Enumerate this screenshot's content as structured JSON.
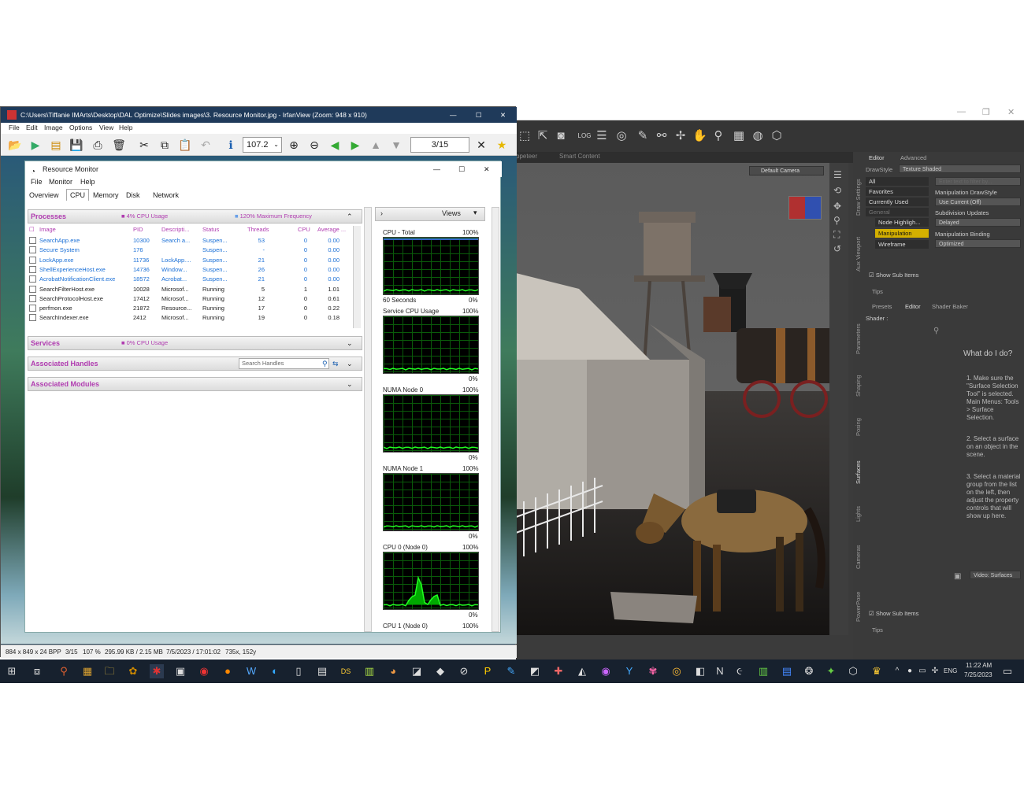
{
  "irfanview": {
    "title": "C:\\Users\\Tiffanie IMArts\\Desktop\\DAL Optimize\\Slides images\\3. Resource Monitor.jpg - IrfanView (Zoom: 948 x 910)",
    "menu": [
      "File",
      "Edit",
      "Image",
      "Options",
      "View",
      "Help"
    ],
    "zoom_value": "107.2",
    "page_value": "3/15",
    "status": [
      "884 x 849 x 24 BPP",
      "3/15",
      "107 %",
      "295.99 KB / 2.15 MB",
      "7/5/2023 / 17:01:02",
      "735x, 152y"
    ]
  },
  "resmon": {
    "title": "Resource Monitor",
    "menu": [
      "File",
      "Monitor",
      "Help"
    ],
    "tabs": [
      "Overview",
      "CPU",
      "Memory",
      "Disk",
      "Network"
    ],
    "processes": {
      "title": "Processes",
      "cpu_usage": "4% CPU Usage",
      "max_freq": "120% Maximum Frequency",
      "columns": [
        "Image",
        "PID",
        "Descripti...",
        "Status",
        "Threads",
        "CPU",
        "Average ..."
      ],
      "rows": [
        {
          "image": "SearchApp.exe",
          "pid": "10300",
          "desc": "Search a...",
          "status": "Suspen...",
          "threads": "53",
          "cpu": "0",
          "avg": "0.00",
          "suspended": true
        },
        {
          "image": "Secure System",
          "pid": "176",
          "desc": "",
          "status": "Suspen...",
          "threads": "-",
          "cpu": "0",
          "avg": "0.00",
          "suspended": true
        },
        {
          "image": "LockApp.exe",
          "pid": "11736",
          "desc": "LockApp....",
          "status": "Suspen...",
          "threads": "21",
          "cpu": "0",
          "avg": "0.00",
          "suspended": true
        },
        {
          "image": "ShellExperienceHost.exe",
          "pid": "14736",
          "desc": "Window...",
          "status": "Suspen...",
          "threads": "26",
          "cpu": "0",
          "avg": "0.00",
          "suspended": true
        },
        {
          "image": "AcrobatNotificationClient.exe",
          "pid": "18572",
          "desc": "Acrobat...",
          "status": "Suspen...",
          "threads": "21",
          "cpu": "0",
          "avg": "0.00",
          "suspended": true
        },
        {
          "image": "SearchFilterHost.exe",
          "pid": "10028",
          "desc": "Microsof...",
          "status": "Running",
          "threads": "5",
          "cpu": "1",
          "avg": "1.01",
          "suspended": false
        },
        {
          "image": "SearchProtocolHost.exe",
          "pid": "17412",
          "desc": "Microsof...",
          "status": "Running",
          "threads": "12",
          "cpu": "0",
          "avg": "0.61",
          "suspended": false
        },
        {
          "image": "perfmon.exe",
          "pid": "21872",
          "desc": "Resource...",
          "status": "Running",
          "threads": "17",
          "cpu": "0",
          "avg": "0.22",
          "suspended": false
        },
        {
          "image": "SearchIndexer.exe",
          "pid": "2412",
          "desc": "Microsof...",
          "status": "Running",
          "threads": "19",
          "cpu": "0",
          "avg": "0.18",
          "suspended": false
        }
      ]
    },
    "services": {
      "title": "Services",
      "cpu_usage": "0% CPU Usage"
    },
    "handles": {
      "title": "Associated Handles",
      "search_placeholder": "Search Handles"
    },
    "modules": {
      "title": "Associated Modules"
    },
    "views_label": "Views",
    "graphs": [
      {
        "label": "CPU - Total",
        "max": "100%",
        "foot_left": "60 Seconds",
        "foot_right": "0%"
      },
      {
        "label": "Service CPU Usage",
        "max": "100%",
        "foot_left": "",
        "foot_right": "0%"
      },
      {
        "label": "NUMA Node 0",
        "max": "100%",
        "foot_left": "",
        "foot_right": "0%"
      },
      {
        "label": "NUMA Node 1",
        "max": "100%",
        "foot_left": "",
        "foot_right": "0%"
      },
      {
        "label": "CPU 0 (Node 0)",
        "max": "100%",
        "foot_left": "",
        "foot_right": "0%"
      },
      {
        "label": "CPU 1 (Node 0)",
        "max": "100%",
        "foot_left": "",
        "foot_right": ""
      }
    ]
  },
  "daz": {
    "tabs": [
      "ppeteer",
      "Smart Content"
    ],
    "camera": "Default Camera",
    "toolbar_log": "LOG",
    "panel": {
      "top_tabs": [
        "Editor",
        "Advanced"
      ],
      "drawstyle_label": "DrawStyle",
      "drawstyle_value": "Texture Shaded",
      "filter_placeholder": "Enter text to filter by...",
      "list": [
        "All",
        "Favorites",
        "Currently Used",
        "General",
        "Node Highligh...",
        "Manipulation",
        "Wireframe"
      ],
      "props": [
        {
          "label": "Manipulation DrawStyle",
          "value": "Use Current (Off)"
        },
        {
          "label": "Subdivision Updates",
          "value": "Delayed"
        },
        {
          "label": "Manipulation Binding",
          "value": "Optimized"
        }
      ],
      "show_sub_items": "Show Sub Items",
      "tips": "Tips",
      "lower_tabs": [
        "Presets",
        "Editor",
        "Shader Baker"
      ],
      "shader_label": "Shader :",
      "what_do_i_do": "What do I do?",
      "steps": [
        "1. Make sure the \"Surface Selection Tool\" is selected. Main Menus: Tools > Surface Selection.",
        "2. Select a surface on an object in the scene.",
        "3. Select a material group from the list on the left, then adjust the property controls that will show up here."
      ],
      "video_button": "Video: Surfaces",
      "side_tabs": [
        "Draw Settings",
        "Aux Viewport",
        "Parameters",
        "Shaping",
        "Posing",
        "Surfaces",
        "Lights",
        "Cameras",
        "PowerPose"
      ]
    }
  },
  "taskbar": {
    "lang": "ENG",
    "time": "11:22 AM",
    "date": "7/25/2023"
  }
}
